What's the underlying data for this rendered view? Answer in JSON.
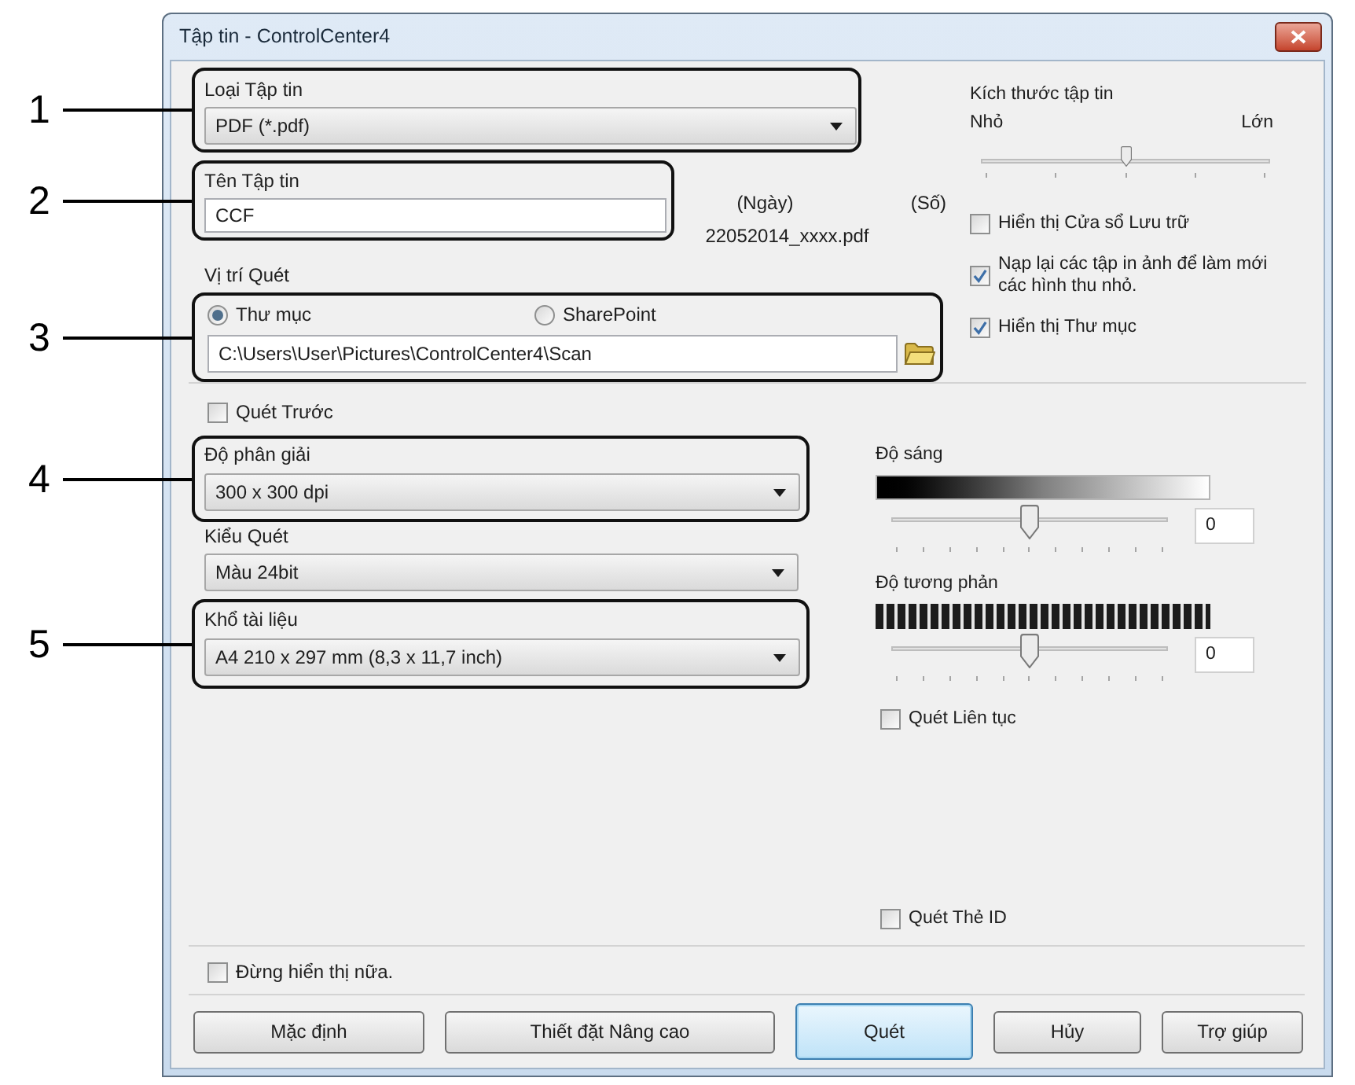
{
  "window": {
    "title": "Tập tin - ControlCenter4"
  },
  "file_type": {
    "callout": "1",
    "label": "Loại Tập tin",
    "value": "PDF (*.pdf)"
  },
  "file_name": {
    "callout": "2",
    "label": "Tên Tập tin",
    "value": "CCF",
    "date_label": "(Ngày)",
    "number_label": "(Số)",
    "example": "22052014_xxxx.pdf"
  },
  "scan_location": {
    "label": "Vị trí Quét",
    "callout": "3",
    "options": [
      {
        "label": "Thư mục",
        "selected": true
      },
      {
        "label": "SharePoint",
        "selected": false
      }
    ],
    "path": "C:\\Users\\User\\Pictures\\ControlCenter4\\Scan"
  },
  "file_size": {
    "label": "Kích thước tập tin",
    "min_label": "Nhỏ",
    "max_label": "Lớn",
    "level": 0.5
  },
  "file_options": [
    {
      "label": "Hiển thị Cửa sổ Lưu trữ",
      "checked": false
    },
    {
      "label": "Nạp lại các tập in ảnh để làm mới các hình thu nhỏ.",
      "checked": true
    },
    {
      "label": "Hiển thị Thư mục",
      "checked": true
    }
  ],
  "prescan": {
    "label": "Quét Trước",
    "checked": false
  },
  "resolution": {
    "callout": "4",
    "label": "Độ phân giải",
    "value": "300 x 300 dpi"
  },
  "scan_type": {
    "label": "Kiểu Quét",
    "value": "Màu 24bit"
  },
  "document_size": {
    "callout": "5",
    "label": "Khổ tài liệu",
    "value": "A4 210 x 297 mm (8,3 x 11,7 inch)"
  },
  "brightness": {
    "label": "Độ sáng",
    "level": 0.5,
    "value": "0"
  },
  "contrast": {
    "label": "Độ tương phản",
    "level": 0.5,
    "value": "0"
  },
  "continuous_scan": {
    "label": "Quét Liên tục",
    "checked": false
  },
  "id_card_scan": {
    "label": "Quét Thẻ ID",
    "checked": false
  },
  "dont_show_again": {
    "label": "Đừng hiển thị nữa.",
    "checked": false
  },
  "buttons": [
    {
      "label": "Mặc định",
      "kind": "normal"
    },
    {
      "label": "Thiết đặt Nâng cao",
      "kind": "normal"
    },
    {
      "label": "Quét",
      "kind": "default"
    },
    {
      "label": "Hủy",
      "kind": "normal"
    },
    {
      "label": "Trợ giúp",
      "kind": "normal"
    }
  ]
}
